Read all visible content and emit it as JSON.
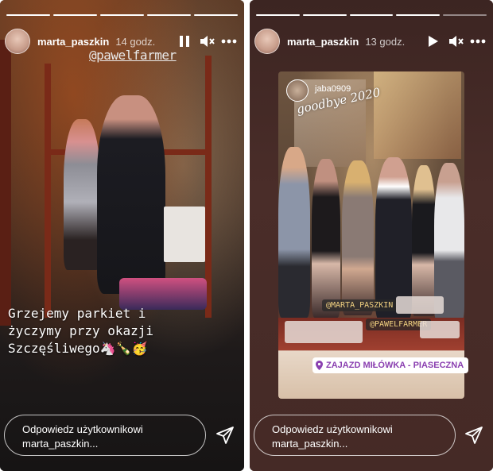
{
  "left_story": {
    "username": "marta_paszkin",
    "time": "14 godz.",
    "mention": "@pawelfarmer",
    "caption_lines": [
      "Grzejemy parkiet i",
      "życzymy przy okazji",
      "Szczęśliwego🦄🍾🥳"
    ],
    "reply_line1": "Odpowiedz użytkownikowi",
    "reply_line2": "marta_paszkin...",
    "progress_done": 5,
    "progress_total": 5
  },
  "right_story": {
    "username": "marta_paszkin",
    "time": "13 godz.",
    "repost_username": "jaba0909",
    "goodbye_text": "goodbye 2020",
    "tag_marta": "@MARTA_PASZKIN",
    "tag_pawel": "@PAWELFARMER",
    "location": "ZAJAZD MIŁÓWKA - PIASECZNA",
    "reply_line1": "Odpowiedz użytkownikowi",
    "reply_line2": "marta_paszkin...",
    "progress_done": 4,
    "progress_total": 5
  },
  "icons": {
    "pause": "pause-icon",
    "play": "play-icon",
    "mute": "speaker-muted-icon",
    "more": "more-dots-icon",
    "send": "paper-plane-icon",
    "location": "location-pin-icon"
  },
  "colors": {
    "location_text": "#8a3fb0",
    "tag_text": "#f0d080"
  }
}
